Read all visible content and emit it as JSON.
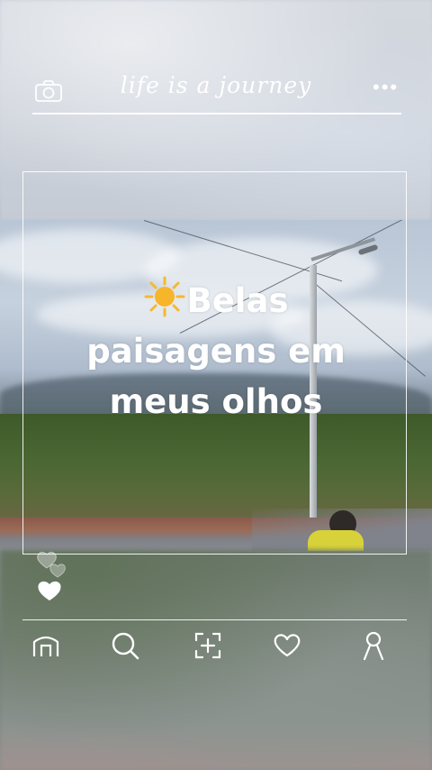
{
  "header": {
    "title": "life is a journey",
    "camera_icon": "camera-icon",
    "more_icon": "more-dots-icon"
  },
  "post": {
    "caption_line1": "Belas",
    "caption_line2": "paisagens em",
    "caption_line3": "meus olhos",
    "caption_emoji": "sun-emoji"
  },
  "likes": {
    "icons": [
      "heart-outline-icon",
      "heart-outline-icon",
      "heart-filled-icon"
    ]
  },
  "nav": {
    "items": [
      {
        "name": "home",
        "icon": "home-icon"
      },
      {
        "name": "search",
        "icon": "search-icon"
      },
      {
        "name": "add",
        "icon": "add-post-icon"
      },
      {
        "name": "favorites",
        "icon": "heart-icon"
      },
      {
        "name": "profile",
        "icon": "profile-icon"
      }
    ]
  },
  "colors": {
    "line_white": "#ffffff",
    "sun": "#f5b92e"
  }
}
